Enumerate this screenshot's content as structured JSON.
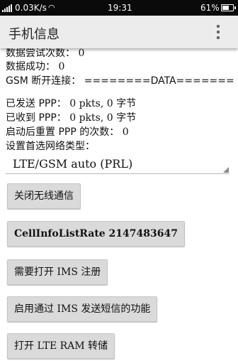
{
  "status_bar": {
    "speed": "0.03K/s",
    "time": "19:31",
    "battery": "61%",
    "wifi_icon": "wifi-icon",
    "signal_icon": "signal-icon",
    "battery_icon": "battery-icon",
    "battery_level": 0.61
  },
  "action_bar": {
    "title": "手机信息",
    "overflow_icon": "more-vert-icon"
  },
  "info": {
    "data_attempts_label": "数据尝试次数：",
    "data_attempts_value": "0",
    "data_success_label": "数据成功：",
    "data_success_value": "0",
    "gsm_disconnect_label": "GSM 断开连接：",
    "gsm_disconnect_value": "========DATA=======",
    "ppp_sent_label": "已发送 PPP：",
    "ppp_sent_value": "0 pkts, 0 字节",
    "ppp_received_label": "已收到 PPP：",
    "ppp_received_value": "0 pkts, 0 字节",
    "ppp_reset_label": "启动后重置 PPP 的次数：",
    "ppp_reset_value": "0",
    "network_type_label": "设置首选网络类型："
  },
  "network_type_select": {
    "selected": "LTE/GSM auto (PRL)"
  },
  "buttons": {
    "radio_off": "关闭无线通信",
    "cell_info_rate": "CellInfoListRate 2147483647",
    "ims_register": "需要打开 IMS 注册",
    "ims_sms": "启用通过 IMS 发送短信的功能",
    "lte_ram_dump": "打开 LTE RAM 转储"
  }
}
